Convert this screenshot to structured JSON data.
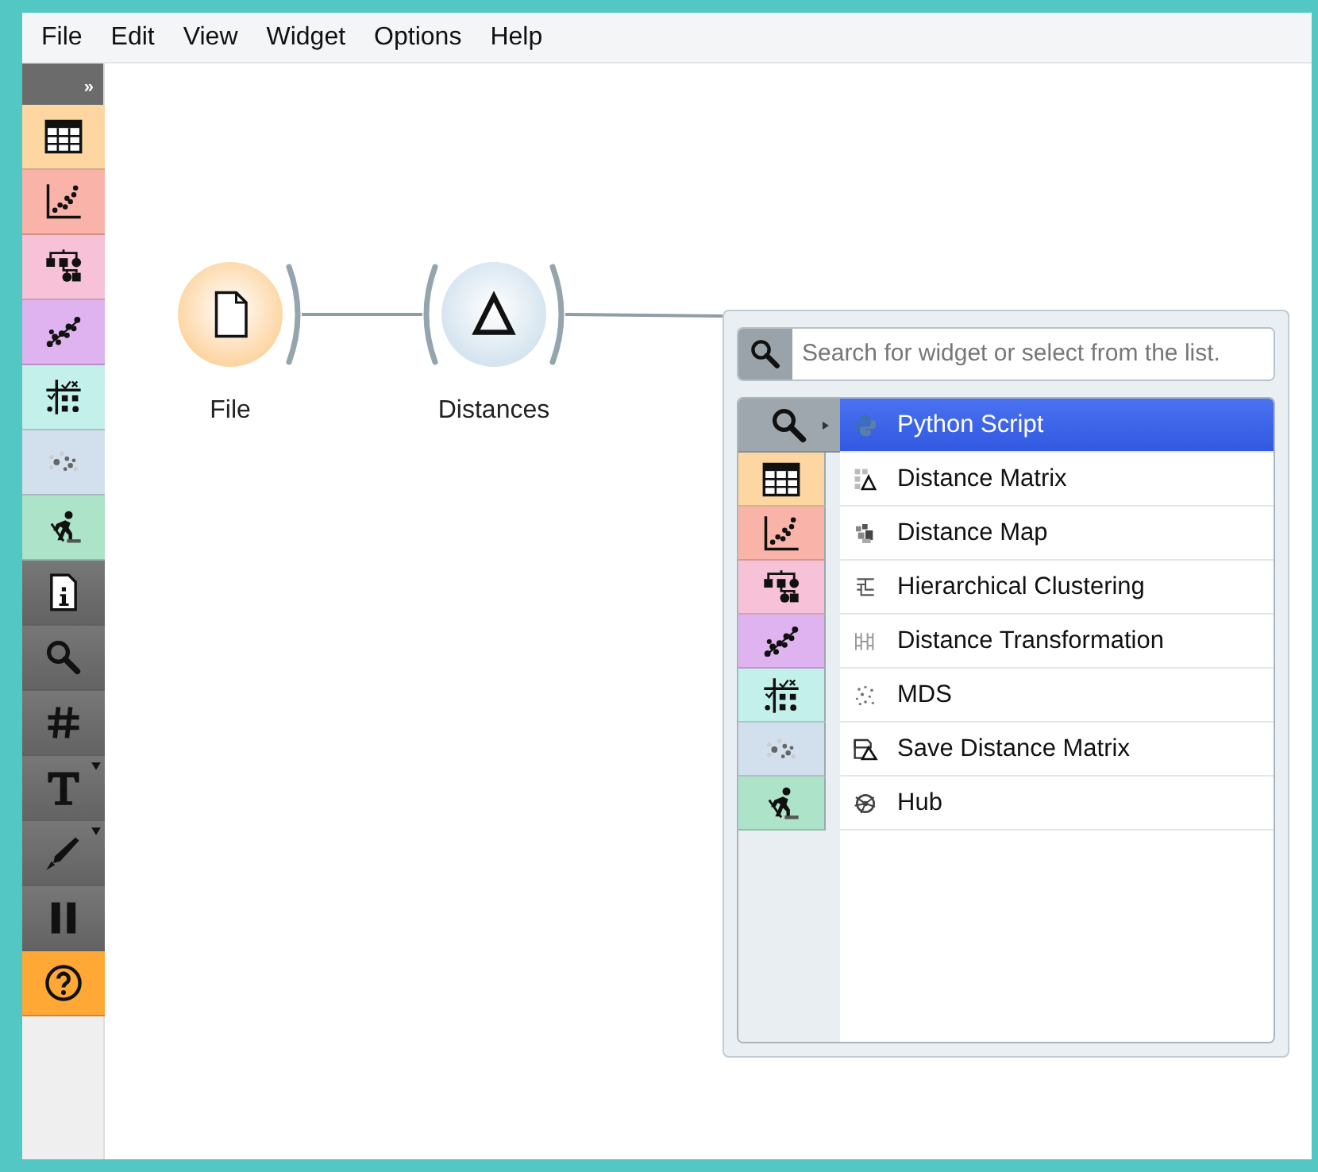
{
  "menu": [
    "File",
    "Edit",
    "View",
    "Widget",
    "Options",
    "Help"
  ],
  "toolbar": {
    "expand": "»",
    "categories": [
      {
        "color": "#fdd6a2"
      },
      {
        "color": "#f9b3a9"
      },
      {
        "color": "#f7c1d8"
      },
      {
        "color": "#deb3f0"
      },
      {
        "color": "#c4f0ec"
      },
      {
        "color": "#d2dfec"
      },
      {
        "color": "#ade3c9"
      }
    ],
    "tools": [
      {
        "dropdown": false,
        "highlighted": false
      },
      {
        "dropdown": false,
        "highlighted": false
      },
      {
        "dropdown": false,
        "highlighted": false
      },
      {
        "dropdown": true,
        "highlighted": false
      },
      {
        "dropdown": true,
        "highlighted": false
      },
      {
        "dropdown": false,
        "highlighted": false
      },
      {
        "dropdown": false,
        "highlighted": true
      }
    ]
  },
  "nodes": [
    {
      "label": "File",
      "color": "#fdd5a3",
      "input": false,
      "output": true
    },
    {
      "label": "Distances",
      "color": "#d5e4ef",
      "input": true,
      "output": true
    }
  ],
  "popup": {
    "search": {
      "placeholder": "Search for widget or select from the list."
    },
    "categories": [
      {
        "color": "#9ea7ad",
        "selected": true
      },
      {
        "color": "#fdd6a2",
        "selected": false
      },
      {
        "color": "#f9b3a9",
        "selected": false
      },
      {
        "color": "#f7c1d8",
        "selected": false
      },
      {
        "color": "#deb3f0",
        "selected": false
      },
      {
        "color": "#c4f0ec",
        "selected": false
      },
      {
        "color": "#d2dfec",
        "selected": false
      },
      {
        "color": "#ade3c9",
        "selected": false
      }
    ],
    "items": [
      {
        "label": "Python Script",
        "selected": true
      },
      {
        "label": "Distance Matrix",
        "selected": false
      },
      {
        "label": "Distance Map",
        "selected": false
      },
      {
        "label": "Hierarchical Clustering",
        "selected": false
      },
      {
        "label": "Distance Transformation",
        "selected": false
      },
      {
        "label": "MDS",
        "selected": false
      },
      {
        "label": "Save Distance Matrix",
        "selected": false
      },
      {
        "label": "Hub",
        "selected": false
      }
    ]
  }
}
